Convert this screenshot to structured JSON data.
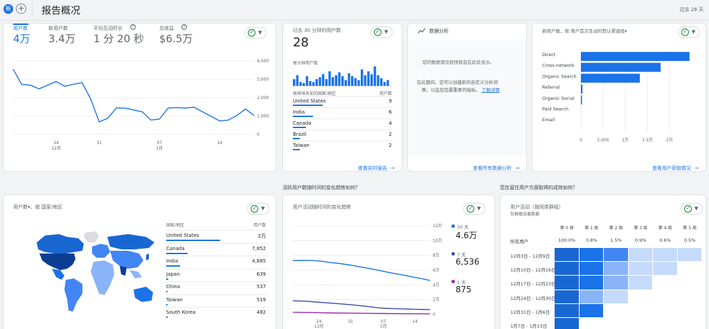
{
  "topbar": {
    "new_badge": "新",
    "add_icon": "+",
    "title": "报告概况",
    "date_range": "过去 28 天"
  },
  "kpi": {
    "metrics": [
      {
        "label": "用户数",
        "value": "4万"
      },
      {
        "label": "新用户数",
        "value": "3.4万"
      },
      {
        "label": "平均互动时长",
        "value": "1 分 20 秒"
      },
      {
        "label": "总收益",
        "value": "$6.5万"
      }
    ],
    "y_ticks": [
      "4,000",
      "3,000",
      "2,000",
      "1,000",
      "0"
    ],
    "x_ticks": [
      {
        "day": "24",
        "month": "12月"
      },
      {
        "day": "31",
        "month": ""
      },
      {
        "day": "07",
        "month": "1月"
      },
      {
        "day": "14",
        "month": ""
      }
    ],
    "series": [
      3550,
      2720,
      2680,
      2480,
      2680,
      2880,
      2620,
      2730,
      2820,
      1940,
      680,
      880,
      1440,
      1430,
      1330,
      1230,
      780,
      830,
      1430,
      1460,
      1430,
      1480,
      1230,
      980,
      730,
      780,
      1030,
      1380,
      1030
    ]
  },
  "realtime": {
    "title": "过去 30 分钟的用户数",
    "value": "28",
    "sub": "每分钟用户数",
    "bars": [
      0.35,
      0.55,
      0.2,
      0.15,
      0.5,
      0.25,
      0.2,
      0.35,
      0.45,
      0.6,
      0.35,
      0.75,
      0.45,
      0.55,
      0.7,
      0.5,
      0.3,
      0.65,
      0.5,
      0.4,
      0.3,
      0.85,
      0.55,
      0.75,
      0.6,
      1.0,
      0.55,
      0.4,
      0.2,
      0.3
    ],
    "col_country": "按排排名前的国家/地区",
    "col_users": "用户数",
    "rows": [
      {
        "name": "United States",
        "value": "9",
        "share": 0.9
      },
      {
        "name": "India",
        "value": "6",
        "share": 0.6
      },
      {
        "name": "Canada",
        "value": "4",
        "share": 0.4
      },
      {
        "name": "Brazil",
        "value": "2",
        "share": 0.2
      },
      {
        "name": "Taiwan",
        "value": "2",
        "share": 0.2
      }
    ],
    "link": "查看实时报告"
  },
  "insights": {
    "title": "数据分析",
    "msg1": "您的数据洞见很快就会在此处显示。",
    "msg2a": "在此期间，您可以创建新的自定义分析洞",
    "msg2b": "察，以监控您最重要的指标。",
    "learn_more": "了解详情",
    "link": "查看所有数据分析"
  },
  "acquisition": {
    "title": "新用户数，按 用户首次互动的默认渠道组",
    "categories": [
      "Direct",
      "Cross-network",
      "Organic Search",
      "Referral",
      "Organic Social",
      "Paid Search",
      "Email"
    ],
    "values": [
      24500,
      18000,
      13300,
      350,
      250,
      0,
      0
    ],
    "x_ticks": [
      "0",
      "5,000",
      "1万",
      "1.5万",
      "2万"
    ],
    "link": "查看用户获取情况"
  },
  "section_q1": "活跃用户数随时间的变化趋势如何？",
  "section_q2": "您在留住用户方面取得的成效如何？",
  "geo": {
    "title": "用户数",
    "title_suffix": "，按 国家/地区",
    "col_country": "国家/地区",
    "col_users": "用户数",
    "rows": [
      {
        "name": "United States",
        "value": "2万",
        "share": 1.0
      },
      {
        "name": "Canada",
        "value": "7,852",
        "share": 0.4
      },
      {
        "name": "India",
        "value": "4,885",
        "share": 0.25
      },
      {
        "name": "Japan",
        "value": "639",
        "share": 0.04
      },
      {
        "name": "China",
        "value": "537",
        "share": 0.03
      },
      {
        "name": "Taiwan",
        "value": "519",
        "share": 0.03
      },
      {
        "name": "South Korea",
        "value": "482",
        "share": 0.03
      }
    ]
  },
  "activity": {
    "title": "用户活动随时间的变化趋势",
    "y_ticks": [
      "12万",
      "10万",
      "8万",
      "6万",
      "4万",
      "2万",
      "0"
    ],
    "x_ticks": [
      {
        "day": "24",
        "month": "12月"
      },
      {
        "day": "31",
        "month": ""
      },
      {
        "day": "07",
        "month": "1月"
      },
      {
        "day": "14",
        "month": ""
      }
    ],
    "legend": [
      {
        "label": "30 天",
        "value": "4.6万",
        "color": "#1a73e8"
      },
      {
        "label": "7 天",
        "value": "6,536",
        "color": "#3949ab"
      },
      {
        "label": "1 天",
        "value": "875",
        "color": "#9c27b0"
      }
    ],
    "s30": [
      73000,
      73000,
      73200,
      72800,
      72000,
      70500,
      69500,
      68200,
      66800,
      65000,
      63200,
      61500,
      59500,
      57500,
      55500,
      53800,
      52000,
      50000,
      48200,
      46000
    ],
    "s7": [
      18500,
      18200,
      17800,
      17000,
      16200,
      15500,
      14800,
      14000,
      13200,
      12200,
      11200,
      10000,
      8800,
      8200,
      7900,
      7600,
      7300,
      7000,
      6800,
      6536
    ],
    "s1": [
      3000,
      2800,
      2600,
      2500,
      2300,
      2100,
      2000,
      1900,
      1800,
      1700,
      1600,
      1500,
      1400,
      1300,
      1200,
      1100,
      1000,
      950,
      900,
      875
    ]
  },
  "cohort": {
    "title": "用户活动（按同类群组）",
    "subtitle": "仅根据设备数据",
    "weeks": [
      "第 0 周",
      "第 1 周",
      "第 2 周",
      "第 3 周",
      "第 4 周",
      "第 5 周"
    ],
    "all_label": "所有用户",
    "all_values": [
      "100.0%",
      "3.8%",
      "1.5%",
      "0.9%",
      "0.6%",
      "0.5%"
    ],
    "rows": [
      {
        "label": "12月3日 - 12月9日",
        "levels": [
          1.0,
          0.85,
          0.45,
          0.2,
          0.15,
          0.12
        ]
      },
      {
        "label": "12月10日 - 12月16日",
        "levels": [
          1.0,
          0.85,
          0.35,
          0.2,
          0.15
        ]
      },
      {
        "label": "12月17日 - 12月23日",
        "levels": [
          1.0,
          0.9,
          0.3,
          0.15
        ]
      },
      {
        "label": "12月24日 - 12月30日",
        "levels": [
          1.0,
          0.3,
          0.15
        ]
      },
      {
        "label": "12月31日 - 1月6日",
        "levels": [
          1.0,
          0.9
        ]
      },
      {
        "label": "1月7日 - 1月13日",
        "levels": [
          1.0
        ]
      }
    ]
  }
}
